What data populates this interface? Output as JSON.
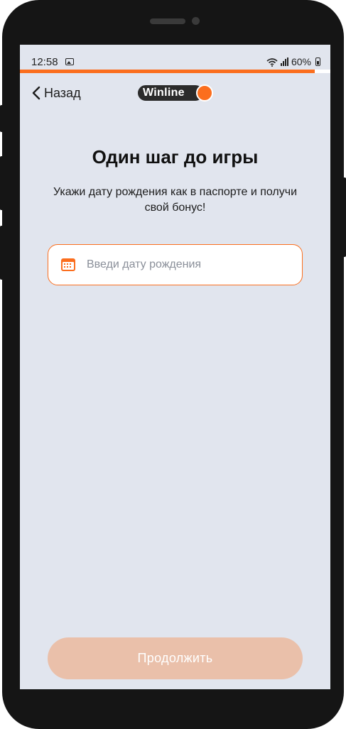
{
  "status_bar": {
    "time": "12:58",
    "battery": "60%",
    "icons": [
      "gallery-icon",
      "wifi-icon",
      "signal-icon",
      "battery-icon"
    ]
  },
  "progress": {
    "fraction": 0.95,
    "color": "#fb6e1e"
  },
  "header": {
    "back_label": "Назад",
    "back_icon": "chevron-left-icon",
    "logo_text": "Winline"
  },
  "main": {
    "title": "Один шаг до игры",
    "subtitle": "Укажи дату рождения как в паспорте и получи свой бонус!",
    "date_field": {
      "placeholder": "Введи дату рождения",
      "value": "",
      "icon": "calendar-icon"
    }
  },
  "footer": {
    "continue_label": "Продолжить",
    "continue_enabled": false
  },
  "colors": {
    "accent": "#fb6e1e",
    "background": "#e1e5ee",
    "button_disabled": "#eac0aa"
  }
}
